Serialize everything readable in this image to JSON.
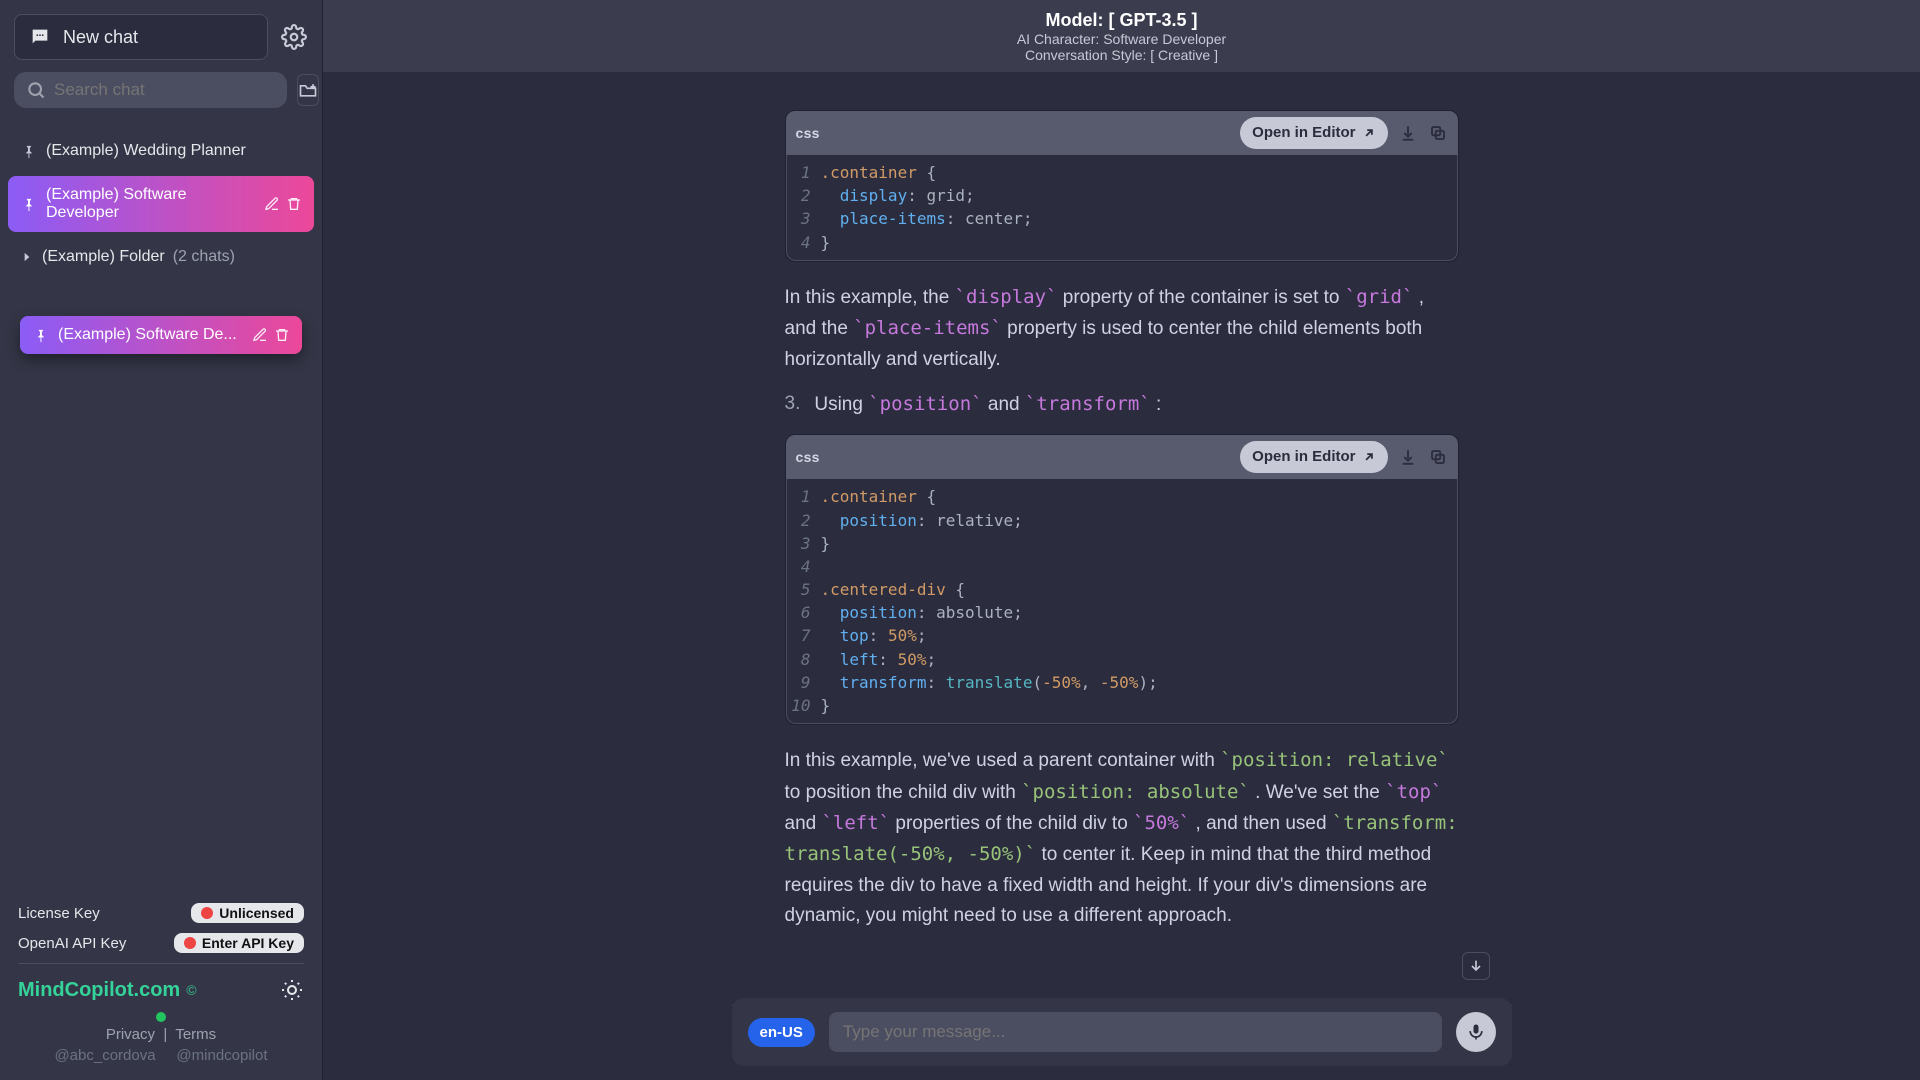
{
  "header": {
    "model": "Model: [ GPT-3.5 ]",
    "character": "AI Character: Software Developer",
    "style": "Conversation Style: [ Creative ]"
  },
  "sidebar": {
    "newchat": "New chat",
    "search_placeholder": "Search chat",
    "chats": [
      {
        "label": "(Example) Wedding Planner"
      },
      {
        "label": "(Example) Software Developer"
      }
    ],
    "folder": {
      "label": "(Example) Folder",
      "meta": "(2 chats)"
    },
    "drag": {
      "label": "(Example) Software De..."
    },
    "license_label": "License Key",
    "license_pill": "Unlicensed",
    "api_label": "OpenAI API Key",
    "api_pill": "Enter API Key",
    "brand": "MindCopilot.com",
    "privacy": "Privacy",
    "terms": "Terms",
    "handle1": "@abc_cordova",
    "handle2": "@mindcopilot"
  },
  "codecards": {
    "lang": "css",
    "open": "Open in Editor"
  },
  "content": {
    "p1_a": "In this example, the ",
    "p1_code1": "`display`",
    "p1_b": " property of the container is set to ",
    "p1_code2": "`grid`",
    "p1_c": ", and the ",
    "p1_code3": "`place-items`",
    "p1_d": " property is used to center the child elements both horizontally and vertically.",
    "li_num": "3.",
    "li_a": "Using ",
    "li_code1": "`position`",
    "li_b": " and ",
    "li_code2": "`transform`",
    "li_c": ":",
    "p2_a": "In this example, we've used a parent container with ",
    "p2_code1": "`position: relative`",
    "p2_b": " to position the child div with ",
    "p2_code2": "`position: absolute`",
    "p2_c": ". We've set the ",
    "p2_code3": "`top`",
    "p2_d": " and ",
    "p2_code4": "`left`",
    "p2_e": " properties of the child div to ",
    "p2_code5": "`50%`",
    "p2_f": ", and then used ",
    "p2_code6": "`transform: translate(-50%, -50%)`",
    "p2_g": " to center it. Keep in mind that the third method requires the div to have a fixed width and height. If your div's dimensions are dynamic, you might need to use a different approach."
  },
  "input": {
    "lang": "en-US",
    "placeholder": "Type your message..."
  }
}
